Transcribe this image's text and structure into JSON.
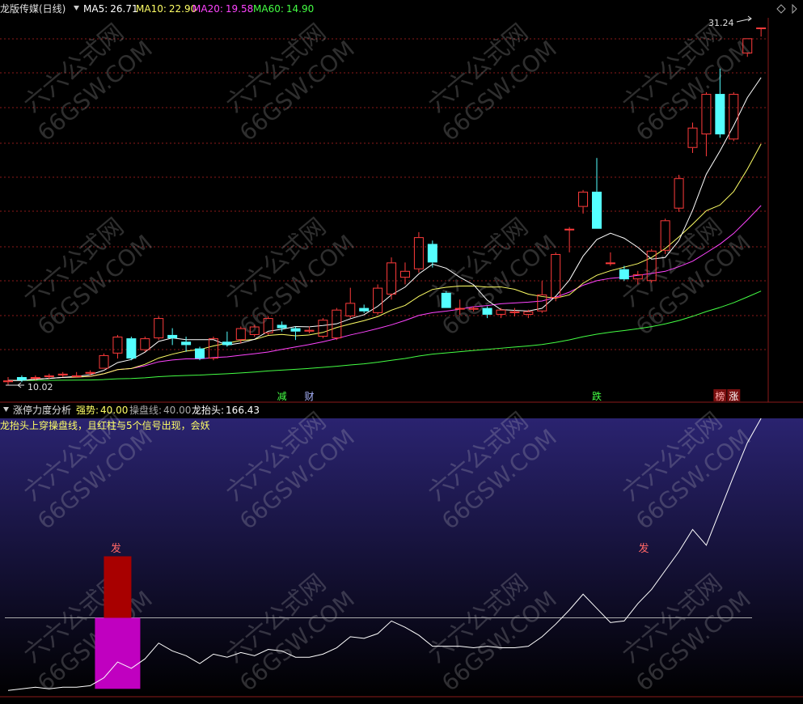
{
  "header": {
    "stock_name": "龙版传媒(日线)",
    "ma5_label": "MA5:",
    "ma5_value": "26.71",
    "ma10_label": "MA10:",
    "ma10_value": "22.90",
    "ma20_label": "MA20:",
    "ma20_value": "19.58",
    "ma60_label": "MA60:",
    "ma60_value": "14.90"
  },
  "indicator_header": {
    "name": "涨停力度分析",
    "strong_label": "强势:",
    "strong_value": "40.00",
    "operate_label": "操盘线:",
    "operate_value": "40.00",
    "dragon_label": "龙抬头:",
    "dragon_value": "166.43",
    "description": "龙抬头上穿操盘线，且红柱与5个信号出现，会妖"
  },
  "markers": {
    "high_label": "31.24",
    "low_label": "10.02",
    "signal_labels": [
      "减",
      "财",
      "跌",
      "榜",
      "涨"
    ],
    "fa_labels": [
      "发",
      "发"
    ]
  },
  "watermark": {
    "line1": "六六公式网",
    "line2": "66GSW.COM"
  },
  "colors": {
    "up": "#ff3b3b",
    "down": "#54ffff",
    "ma5": "#ffffff",
    "ma10": "#ffff66",
    "ma20": "#ff44ff",
    "ma60": "#44ff44",
    "grid": "#8b1a1a",
    "indicator_bg_top": "#2a2370",
    "indicator_bg_bottom": "#000000",
    "bar_red": "#a80000",
    "bar_magenta": "#c000c0"
  },
  "chart_data": [
    {
      "type": "candlestick",
      "title": "龙版传媒(日线)",
      "ylim": [
        10.02,
        31.24
      ],
      "candles": [
        {
          "o": 10.2,
          "c": 10.3,
          "h": 10.5,
          "l": 10.02
        },
        {
          "o": 10.5,
          "c": 10.3,
          "h": 10.6,
          "l": 10.2
        },
        {
          "o": 10.4,
          "c": 10.5,
          "h": 10.6,
          "l": 10.3
        },
        {
          "o": 10.5,
          "c": 10.6,
          "h": 10.7,
          "l": 10.4
        },
        {
          "o": 10.6,
          "c": 10.7,
          "h": 10.8,
          "l": 10.5
        },
        {
          "o": 10.6,
          "c": 10.6,
          "h": 10.8,
          "l": 10.5
        },
        {
          "o": 10.7,
          "c": 10.8,
          "h": 10.9,
          "l": 10.6
        },
        {
          "o": 11.0,
          "c": 11.8,
          "h": 11.9,
          "l": 11.0
        },
        {
          "o": 11.9,
          "c": 12.9,
          "h": 13.0,
          "l": 11.6
        },
        {
          "o": 12.8,
          "c": 11.6,
          "h": 12.9,
          "l": 11.5
        },
        {
          "o": 12.1,
          "c": 12.8,
          "h": 12.9,
          "l": 12.0
        },
        {
          "o": 12.8,
          "c": 14.0,
          "h": 14.1,
          "l": 12.7
        },
        {
          "o": 13.0,
          "c": 12.8,
          "h": 13.4,
          "l": 12.4
        },
        {
          "o": 12.6,
          "c": 12.4,
          "h": 12.9,
          "l": 12.0
        },
        {
          "o": 12.2,
          "c": 11.6,
          "h": 12.3,
          "l": 11.5
        },
        {
          "o": 11.6,
          "c": 12.8,
          "h": 12.9,
          "l": 11.5
        },
        {
          "o": 12.6,
          "c": 12.4,
          "h": 13.2,
          "l": 12.3
        },
        {
          "o": 12.7,
          "c": 13.4,
          "h": 13.5,
          "l": 12.5
        },
        {
          "o": 13.0,
          "c": 13.5,
          "h": 13.6,
          "l": 12.9
        },
        {
          "o": 13.1,
          "c": 14.0,
          "h": 14.1,
          "l": 13.0
        },
        {
          "o": 13.6,
          "c": 13.4,
          "h": 13.8,
          "l": 13.2
        },
        {
          "o": 13.4,
          "c": 13.2,
          "h": 13.5,
          "l": 12.7
        },
        {
          "o": 13.2,
          "c": 13.3,
          "h": 13.5,
          "l": 13.1
        },
        {
          "o": 12.9,
          "c": 13.9,
          "h": 14.0,
          "l": 12.8
        },
        {
          "o": 12.8,
          "c": 14.5,
          "h": 14.6,
          "l": 12.7
        },
        {
          "o": 14.1,
          "c": 14.9,
          "h": 15.8,
          "l": 14.0
        },
        {
          "o": 14.6,
          "c": 14.4,
          "h": 14.8,
          "l": 14.3
        },
        {
          "o": 14.3,
          "c": 15.8,
          "h": 16.0,
          "l": 14.2
        },
        {
          "o": 15.4,
          "c": 17.3,
          "h": 17.6,
          "l": 15.1
        },
        {
          "o": 16.4,
          "c": 16.8,
          "h": 17.3,
          "l": 16.0
        },
        {
          "o": 16.9,
          "c": 18.8,
          "h": 19.1,
          "l": 16.7
        },
        {
          "o": 18.4,
          "c": 17.3,
          "h": 18.6,
          "l": 17.0
        },
        {
          "o": 15.5,
          "c": 14.6,
          "h": 15.6,
          "l": 14.6
        },
        {
          "o": 14.6,
          "c": 14.6,
          "h": 15.1,
          "l": 14.2
        },
        {
          "o": 14.5,
          "c": 14.6,
          "h": 14.7,
          "l": 14.4
        },
        {
          "o": 14.6,
          "c": 14.2,
          "h": 14.7,
          "l": 14.0
        },
        {
          "o": 14.2,
          "c": 14.5,
          "h": 14.6,
          "l": 14.0
        },
        {
          "o": 14.3,
          "c": 14.4,
          "h": 14.6,
          "l": 14.1
        },
        {
          "o": 14.2,
          "c": 14.4,
          "h": 14.5,
          "l": 14.0
        },
        {
          "o": 14.4,
          "c": 15.4,
          "h": 16.2,
          "l": 14.3
        },
        {
          "o": 15.2,
          "c": 17.8,
          "h": 17.9,
          "l": 15.0
        },
        {
          "o": 19.3,
          "c": 19.3,
          "h": 19.4,
          "l": 17.9
        },
        {
          "o": 20.6,
          "c": 21.5,
          "h": 21.6,
          "l": 20.2
        },
        {
          "o": 21.5,
          "c": 19.3,
          "h": 23.5,
          "l": 19.3
        },
        {
          "o": 17.3,
          "c": 17.3,
          "h": 17.9,
          "l": 17.1
        },
        {
          "o": 16.9,
          "c": 16.3,
          "h": 17.1,
          "l": 16.2
        },
        {
          "o": 16.3,
          "c": 16.6,
          "h": 16.8,
          "l": 16.0
        },
        {
          "o": 16.2,
          "c": 18.0,
          "h": 18.1,
          "l": 16.1
        },
        {
          "o": 18.0,
          "c": 19.8,
          "h": 19.9,
          "l": 17.8
        },
        {
          "o": 20.5,
          "c": 22.3,
          "h": 22.5,
          "l": 20.3
        },
        {
          "o": 24.1,
          "c": 25.3,
          "h": 25.6,
          "l": 23.8
        },
        {
          "o": 24.9,
          "c": 27.3,
          "h": 27.4,
          "l": 23.6
        },
        {
          "o": 27.3,
          "c": 24.9,
          "h": 28.8,
          "l": 24.7
        },
        {
          "o": 24.6,
          "c": 27.3,
          "h": 27.4,
          "l": 24.5
        },
        {
          "o": 29.7,
          "c": 30.6,
          "h": 30.6,
          "l": 29.5
        },
        {
          "o": 31.2,
          "c": 31.24,
          "h": 31.24,
          "l": 30.7
        }
      ]
    },
    {
      "type": "line",
      "title": "涨停力度分析",
      "series": [
        {
          "name": "操盘线",
          "values": [
            40,
            40,
            40,
            40,
            40,
            40,
            40,
            40,
            40,
            40,
            40,
            40,
            40,
            40,
            40,
            40,
            40,
            40,
            40,
            40,
            40,
            40,
            40,
            40,
            40,
            40,
            40,
            40,
            40,
            40,
            40,
            40,
            40,
            40,
            40,
            40,
            40,
            40,
            40,
            40,
            40,
            40,
            40,
            40,
            40,
            40,
            40,
            40,
            40,
            40,
            40,
            40,
            40,
            40,
            40,
            40
          ]
        },
        {
          "name": "龙抬头",
          "values": [
            -6,
            -5,
            -4,
            -5,
            -4,
            -4,
            -3,
            2,
            12,
            8,
            14,
            24,
            19,
            16,
            11,
            17,
            15,
            18,
            16,
            20,
            19,
            15,
            15,
            17,
            21,
            28,
            27,
            30,
            38,
            34,
            29,
            22,
            22,
            22,
            21,
            22,
            21,
            21,
            22,
            28,
            36,
            45,
            55,
            46,
            37,
            38,
            49,
            58,
            70,
            82,
            96,
            86,
            108,
            130,
            151,
            166.43
          ]
        }
      ],
      "bars": [
        {
          "index": 8,
          "value": 40,
          "color": "#c000c0"
        },
        {
          "index": 8,
          "value": 79,
          "color": "#a80000"
        }
      ]
    }
  ]
}
